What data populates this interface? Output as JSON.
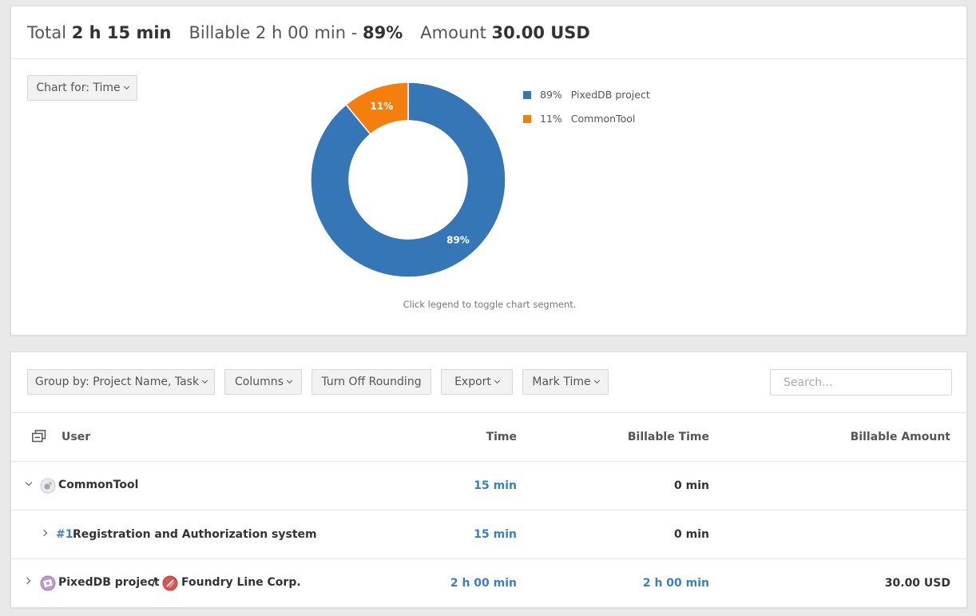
{
  "summary": {
    "total_label": "Total",
    "total_value": "2 h 15 min",
    "billable_label": "Billable",
    "billable_value": "2 h 00 min -",
    "billable_pct": "89%",
    "amount_label": "Amount",
    "amount_value": "30.00 USD"
  },
  "chart_for_label": "Chart for: Time",
  "chart_data": {
    "type": "pie",
    "title": "",
    "slices": [
      {
        "name": "PixedDB project",
        "value": 89,
        "label": "89%",
        "color": "#3576b6"
      },
      {
        "name": "CommonTool",
        "value": 11,
        "label": "11%",
        "color": "#f57f0c"
      }
    ]
  },
  "legend": [
    {
      "pct": "89%",
      "name": "PixedDB project",
      "color": "#3576b6"
    },
    {
      "pct": "11%",
      "name": "CommonTool",
      "color": "#f57f0c"
    }
  ],
  "chart_hint": "Click legend to toggle chart segment.",
  "toolbar": {
    "group_by": "Group by: Project Name, Task",
    "columns": "Columns",
    "rounding": "Turn Off Rounding",
    "export": "Export",
    "mark_time": "Mark Time",
    "search_placeholder": "Search..."
  },
  "table": {
    "headers": {
      "user": "User",
      "time": "Time",
      "billable_time": "Billable Time",
      "billable_amount": "Billable Amount"
    },
    "rows": [
      {
        "name": "CommonTool",
        "time": "15 min",
        "billable_time": "0 min",
        "amount": ""
      },
      {
        "number": "#1",
        "name": "Registration and Authorization system",
        "time": "15 min",
        "billable_time": "0 min",
        "amount": ""
      },
      {
        "name": "PixedDB project",
        "separator": "/",
        "client": "Foundry Line Corp.",
        "time": "2 h 00 min",
        "billable_time": "2 h 00 min",
        "amount": "30.00 USD"
      }
    ]
  }
}
